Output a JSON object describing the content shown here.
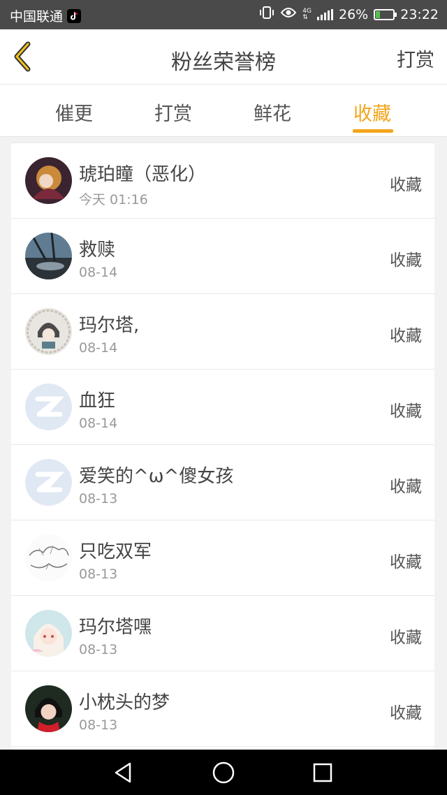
{
  "status_bar": {
    "carrier": "中国联通",
    "network": "4G",
    "battery_percent": "26%",
    "battery_level": 0.26,
    "time": "23:22"
  },
  "header": {
    "back_icon": "chevron-left-icon",
    "title": "粉丝荣誉榜",
    "right_action": "打赏"
  },
  "tabs": [
    {
      "label": "催更",
      "active": false
    },
    {
      "label": "打赏",
      "active": false
    },
    {
      "label": "鲜花",
      "active": false
    },
    {
      "label": "收藏",
      "active": true
    }
  ],
  "accent_color": "#f3a51b",
  "list": [
    {
      "name": "琥珀瞳（恶化）",
      "date": "今天 01:16",
      "action": "收藏"
    },
    {
      "name": "救赎",
      "date": "08-14",
      "action": "收藏"
    },
    {
      "name": "玛尔塔,",
      "date": "08-14",
      "action": "收藏"
    },
    {
      "name": "血狂",
      "date": "08-14",
      "action": "收藏"
    },
    {
      "name": "爱笑的^ω^傻女孩",
      "date": "08-13",
      "action": "收藏"
    },
    {
      "name": "只吃双军",
      "date": "08-13",
      "action": "收藏"
    },
    {
      "name": "玛尔塔嘿",
      "date": "08-13",
      "action": "收藏"
    },
    {
      "name": "小枕头的梦",
      "date": "08-13",
      "action": "收藏"
    }
  ],
  "nav_bar": {
    "back": "triangle-back-icon",
    "home": "circle-home-icon",
    "recents": "square-recents-icon"
  }
}
